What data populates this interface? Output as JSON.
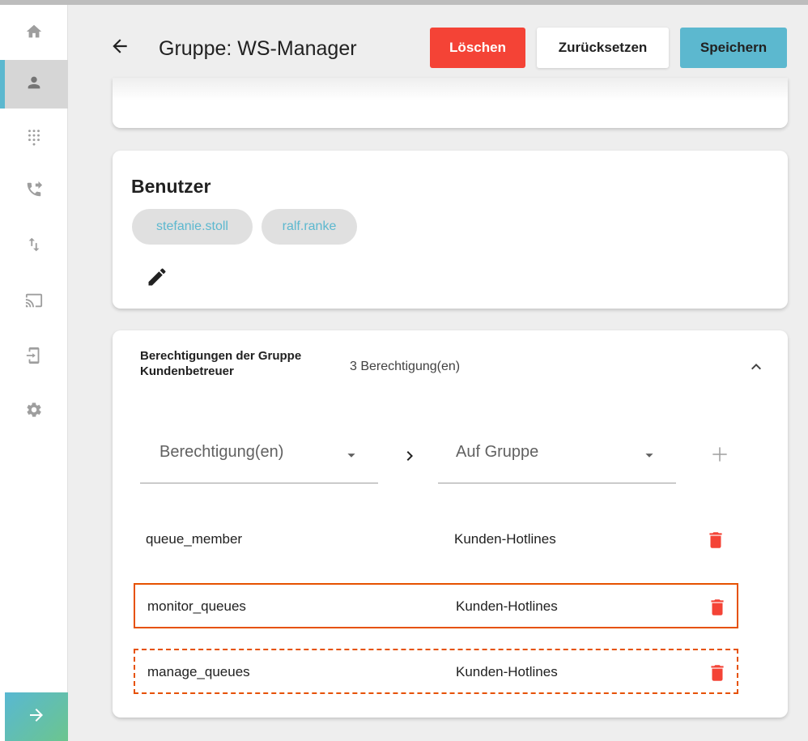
{
  "sidebar": {
    "items": [
      {
        "icon": "home-icon"
      },
      {
        "icon": "person-icon",
        "active": true
      },
      {
        "icon": "dialpad-icon"
      },
      {
        "icon": "phone-forward-icon"
      },
      {
        "icon": "swap-vert-icon"
      },
      {
        "icon": "cast-icon"
      },
      {
        "icon": "device-login-icon"
      },
      {
        "icon": "gear-icon"
      }
    ],
    "collapse_icon": "arrow-right-icon"
  },
  "header": {
    "title": "Gruppe: WS-Manager",
    "delete_label": "Löschen",
    "reset_label": "Zurücksetzen",
    "save_label": "Speichern"
  },
  "users": {
    "title": "Benutzer",
    "chips": [
      "stefanie.stoll",
      "ralf.ranke"
    ]
  },
  "permissions": {
    "title": "Berechtigungen der Gruppe Kundenbetreuer",
    "count": "3 Berechtigung(en)",
    "select_permission_placeholder": "Berechtigung(en)",
    "select_group_placeholder": "Auf Gruppe",
    "rows": [
      {
        "name": "queue_member",
        "group": "Kunden-Hotlines"
      },
      {
        "name": "monitor_queues",
        "group": "Kunden-Hotlines"
      },
      {
        "name": "manage_queues",
        "group": "Kunden-Hotlines"
      }
    ]
  },
  "colors": {
    "accent": "#5cb8cf",
    "danger": "#f44336",
    "highlight": "#e65100"
  }
}
